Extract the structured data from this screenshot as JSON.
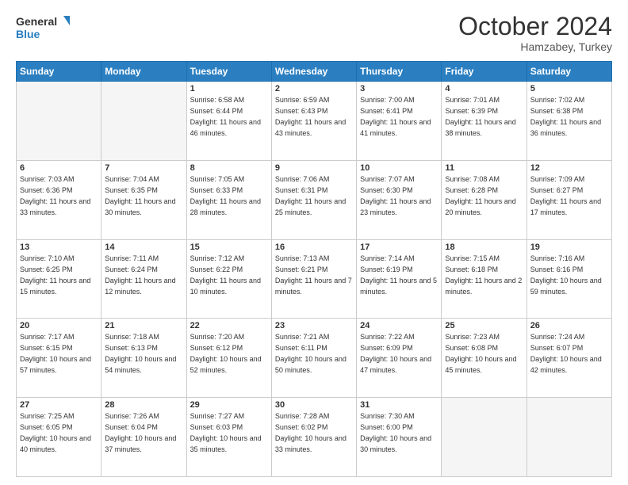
{
  "logo": {
    "line1": "General",
    "line2": "Blue"
  },
  "title": "October 2024",
  "location": "Hamzabey, Turkey",
  "days_of_week": [
    "Sunday",
    "Monday",
    "Tuesday",
    "Wednesday",
    "Thursday",
    "Friday",
    "Saturday"
  ],
  "weeks": [
    [
      {
        "day": "",
        "sunrise": "",
        "sunset": "",
        "daylight": ""
      },
      {
        "day": "",
        "sunrise": "",
        "sunset": "",
        "daylight": ""
      },
      {
        "day": "1",
        "sunrise": "Sunrise: 6:58 AM",
        "sunset": "Sunset: 6:44 PM",
        "daylight": "Daylight: 11 hours and 46 minutes."
      },
      {
        "day": "2",
        "sunrise": "Sunrise: 6:59 AM",
        "sunset": "Sunset: 6:43 PM",
        "daylight": "Daylight: 11 hours and 43 minutes."
      },
      {
        "day": "3",
        "sunrise": "Sunrise: 7:00 AM",
        "sunset": "Sunset: 6:41 PM",
        "daylight": "Daylight: 11 hours and 41 minutes."
      },
      {
        "day": "4",
        "sunrise": "Sunrise: 7:01 AM",
        "sunset": "Sunset: 6:39 PM",
        "daylight": "Daylight: 11 hours and 38 minutes."
      },
      {
        "day": "5",
        "sunrise": "Sunrise: 7:02 AM",
        "sunset": "Sunset: 6:38 PM",
        "daylight": "Daylight: 11 hours and 36 minutes."
      }
    ],
    [
      {
        "day": "6",
        "sunrise": "Sunrise: 7:03 AM",
        "sunset": "Sunset: 6:36 PM",
        "daylight": "Daylight: 11 hours and 33 minutes."
      },
      {
        "day": "7",
        "sunrise": "Sunrise: 7:04 AM",
        "sunset": "Sunset: 6:35 PM",
        "daylight": "Daylight: 11 hours and 30 minutes."
      },
      {
        "day": "8",
        "sunrise": "Sunrise: 7:05 AM",
        "sunset": "Sunset: 6:33 PM",
        "daylight": "Daylight: 11 hours and 28 minutes."
      },
      {
        "day": "9",
        "sunrise": "Sunrise: 7:06 AM",
        "sunset": "Sunset: 6:31 PM",
        "daylight": "Daylight: 11 hours and 25 minutes."
      },
      {
        "day": "10",
        "sunrise": "Sunrise: 7:07 AM",
        "sunset": "Sunset: 6:30 PM",
        "daylight": "Daylight: 11 hours and 23 minutes."
      },
      {
        "day": "11",
        "sunrise": "Sunrise: 7:08 AM",
        "sunset": "Sunset: 6:28 PM",
        "daylight": "Daylight: 11 hours and 20 minutes."
      },
      {
        "day": "12",
        "sunrise": "Sunrise: 7:09 AM",
        "sunset": "Sunset: 6:27 PM",
        "daylight": "Daylight: 11 hours and 17 minutes."
      }
    ],
    [
      {
        "day": "13",
        "sunrise": "Sunrise: 7:10 AM",
        "sunset": "Sunset: 6:25 PM",
        "daylight": "Daylight: 11 hours and 15 minutes."
      },
      {
        "day": "14",
        "sunrise": "Sunrise: 7:11 AM",
        "sunset": "Sunset: 6:24 PM",
        "daylight": "Daylight: 11 hours and 12 minutes."
      },
      {
        "day": "15",
        "sunrise": "Sunrise: 7:12 AM",
        "sunset": "Sunset: 6:22 PM",
        "daylight": "Daylight: 11 hours and 10 minutes."
      },
      {
        "day": "16",
        "sunrise": "Sunrise: 7:13 AM",
        "sunset": "Sunset: 6:21 PM",
        "daylight": "Daylight: 11 hours and 7 minutes."
      },
      {
        "day": "17",
        "sunrise": "Sunrise: 7:14 AM",
        "sunset": "Sunset: 6:19 PM",
        "daylight": "Daylight: 11 hours and 5 minutes."
      },
      {
        "day": "18",
        "sunrise": "Sunrise: 7:15 AM",
        "sunset": "Sunset: 6:18 PM",
        "daylight": "Daylight: 11 hours and 2 minutes."
      },
      {
        "day": "19",
        "sunrise": "Sunrise: 7:16 AM",
        "sunset": "Sunset: 6:16 PM",
        "daylight": "Daylight: 10 hours and 59 minutes."
      }
    ],
    [
      {
        "day": "20",
        "sunrise": "Sunrise: 7:17 AM",
        "sunset": "Sunset: 6:15 PM",
        "daylight": "Daylight: 10 hours and 57 minutes."
      },
      {
        "day": "21",
        "sunrise": "Sunrise: 7:18 AM",
        "sunset": "Sunset: 6:13 PM",
        "daylight": "Daylight: 10 hours and 54 minutes."
      },
      {
        "day": "22",
        "sunrise": "Sunrise: 7:20 AM",
        "sunset": "Sunset: 6:12 PM",
        "daylight": "Daylight: 10 hours and 52 minutes."
      },
      {
        "day": "23",
        "sunrise": "Sunrise: 7:21 AM",
        "sunset": "Sunset: 6:11 PM",
        "daylight": "Daylight: 10 hours and 50 minutes."
      },
      {
        "day": "24",
        "sunrise": "Sunrise: 7:22 AM",
        "sunset": "Sunset: 6:09 PM",
        "daylight": "Daylight: 10 hours and 47 minutes."
      },
      {
        "day": "25",
        "sunrise": "Sunrise: 7:23 AM",
        "sunset": "Sunset: 6:08 PM",
        "daylight": "Daylight: 10 hours and 45 minutes."
      },
      {
        "day": "26",
        "sunrise": "Sunrise: 7:24 AM",
        "sunset": "Sunset: 6:07 PM",
        "daylight": "Daylight: 10 hours and 42 minutes."
      }
    ],
    [
      {
        "day": "27",
        "sunrise": "Sunrise: 7:25 AM",
        "sunset": "Sunset: 6:05 PM",
        "daylight": "Daylight: 10 hours and 40 minutes."
      },
      {
        "day": "28",
        "sunrise": "Sunrise: 7:26 AM",
        "sunset": "Sunset: 6:04 PM",
        "daylight": "Daylight: 10 hours and 37 minutes."
      },
      {
        "day": "29",
        "sunrise": "Sunrise: 7:27 AM",
        "sunset": "Sunset: 6:03 PM",
        "daylight": "Daylight: 10 hours and 35 minutes."
      },
      {
        "day": "30",
        "sunrise": "Sunrise: 7:28 AM",
        "sunset": "Sunset: 6:02 PM",
        "daylight": "Daylight: 10 hours and 33 minutes."
      },
      {
        "day": "31",
        "sunrise": "Sunrise: 7:30 AM",
        "sunset": "Sunset: 6:00 PM",
        "daylight": "Daylight: 10 hours and 30 minutes."
      },
      {
        "day": "",
        "sunrise": "",
        "sunset": "",
        "daylight": ""
      },
      {
        "day": "",
        "sunrise": "",
        "sunset": "",
        "daylight": ""
      }
    ]
  ]
}
